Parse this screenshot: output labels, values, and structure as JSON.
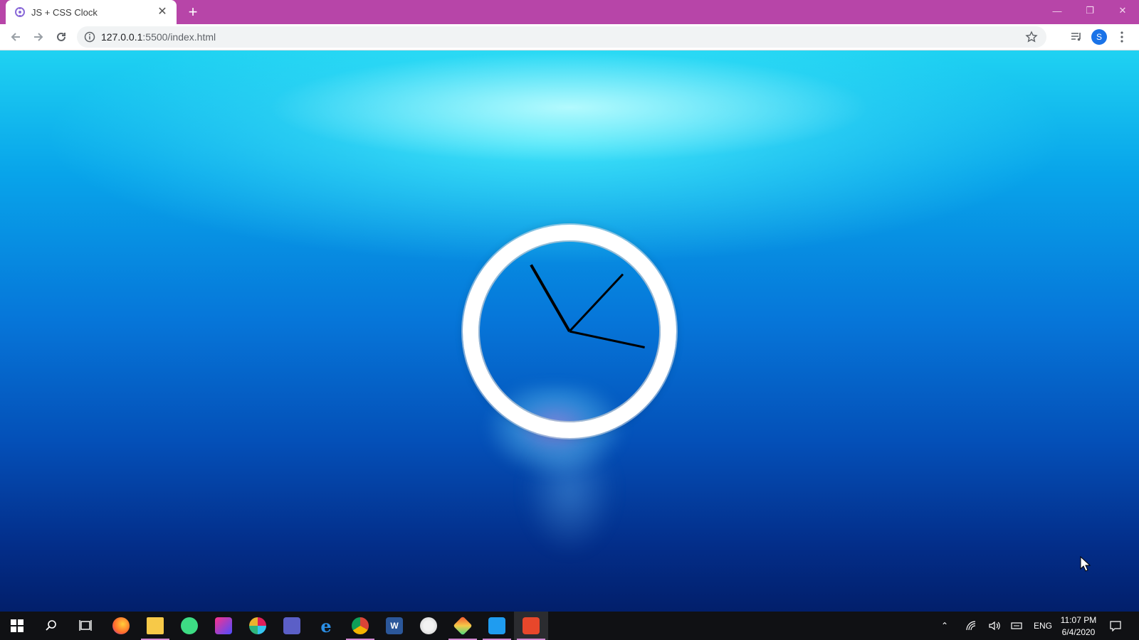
{
  "browser": {
    "tab_title": "JS + CSS Clock",
    "url_host": "127.0.0.1",
    "url_path": ":5500/index.html",
    "profile_initial": "S",
    "titlebar_color": "#b745a8"
  },
  "page": {
    "clock": {
      "hour_angle_deg": 330,
      "minute_angle_deg": 43,
      "second_angle_deg": 102,
      "face_border_color": "#ffffff",
      "hand_color": "#000000"
    }
  },
  "taskbar": {
    "apps": [
      {
        "name": "firefox-icon"
      },
      {
        "name": "file-explorer-icon"
      },
      {
        "name": "android-studio-icon"
      },
      {
        "name": "intellij-icon"
      },
      {
        "name": "slack-icon"
      },
      {
        "name": "teams-icon"
      },
      {
        "name": "edge-icon"
      },
      {
        "name": "chrome-icon"
      },
      {
        "name": "word-icon"
      },
      {
        "name": "paint-icon"
      },
      {
        "name": "git-icon"
      },
      {
        "name": "vscode-icon"
      },
      {
        "name": "screen-recorder-icon"
      }
    ],
    "language": "ENG",
    "time": "11:07 PM",
    "date": "6/4/2020"
  }
}
